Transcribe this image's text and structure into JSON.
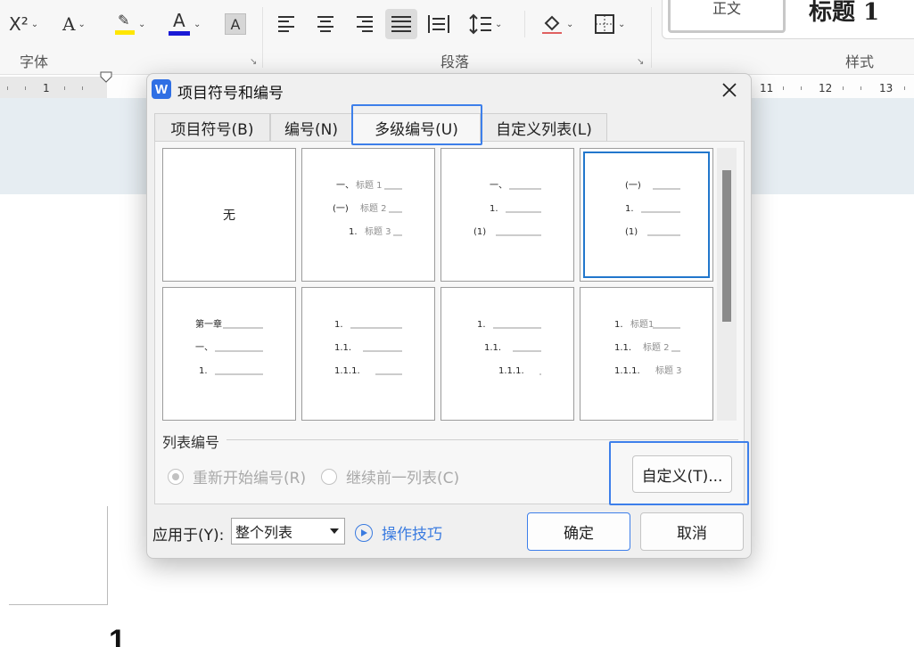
{
  "ribbon": {
    "groups": {
      "font": "字体",
      "paragraph": "段落",
      "styles": "样式"
    },
    "buttons": {
      "superscript": "X²",
      "font_effect": "A",
      "font_color": "A",
      "char_shading": "A"
    },
    "highlight_color": "#ffe600",
    "font_color_value": "#1a1ad6",
    "styles": {
      "normal": "正文",
      "heading1": "标题 1"
    }
  },
  "ruler": {
    "left_number": "1",
    "right_numbers": [
      "11",
      "12",
      "13"
    ]
  },
  "document": {
    "visible_heading": "1"
  },
  "dialog": {
    "app_icon_letter": "W",
    "title": "项目符号和编号",
    "tabs": [
      {
        "label": "项目符号(B)"
      },
      {
        "label": "编号(N)"
      },
      {
        "label": "多级编号(U)",
        "active": true
      },
      {
        "label": "自定义列表(L)"
      }
    ],
    "gallery": {
      "none_label": "无",
      "selected_index": 3,
      "tiles": [
        {
          "kind": "none"
        },
        {
          "kind": "outline",
          "levels": [
            {
              "marker": "一、",
              "text": "标题 1"
            },
            {
              "marker": "(一)",
              "text": "标题 2"
            },
            {
              "marker": "1.",
              "text": "标题 3"
            }
          ]
        },
        {
          "kind": "outline",
          "levels": [
            {
              "marker": "一、",
              "text": ""
            },
            {
              "marker": "1.",
              "text": ""
            },
            {
              "marker": "(1)",
              "text": ""
            }
          ]
        },
        {
          "kind": "outline",
          "levels": [
            {
              "marker": "(一)",
              "text": ""
            },
            {
              "marker": "1.",
              "text": ""
            },
            {
              "marker": "(1)",
              "text": ""
            }
          ]
        },
        {
          "kind": "outline",
          "levels": [
            {
              "marker": "第一章",
              "text": ""
            },
            {
              "marker": "一、",
              "text": ""
            },
            {
              "marker": "1.",
              "text": ""
            }
          ]
        },
        {
          "kind": "outline",
          "levels": [
            {
              "marker": "1.",
              "text": ""
            },
            {
              "marker": "1.1.",
              "text": ""
            },
            {
              "marker": "1.1.1.",
              "text": ""
            }
          ]
        },
        {
          "kind": "outline",
          "levels": [
            {
              "marker": "1.",
              "text": ""
            },
            {
              "marker": "1.1.",
              "text": ""
            },
            {
              "marker": "1.1.1.",
              "text": ""
            }
          ]
        },
        {
          "kind": "outline",
          "levels": [
            {
              "marker": "1.",
              "text": "标题1"
            },
            {
              "marker": "1.1.",
              "text": "标题 2"
            },
            {
              "marker": "1.1.1.",
              "text": "标题 3"
            }
          ]
        }
      ]
    },
    "list_numbering": {
      "section_label": "列表编号",
      "restart_label": "重新开始编号(R)",
      "continue_label": "继续前一列表(C)",
      "restart_selected": true
    },
    "customize_button": "自定义(T)...",
    "apply_to": {
      "label": "应用于(Y):",
      "value": "整个列表"
    },
    "tips_link": "操作技巧",
    "ok_button": "确定",
    "cancel_button": "取消",
    "accent_color": "#3d7fea"
  }
}
